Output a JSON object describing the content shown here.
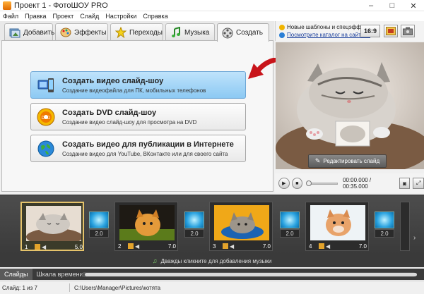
{
  "window": {
    "title": "Проект 1 - ФотоШОУ PRO",
    "controls": {
      "minimize": "–",
      "maximize": "□",
      "close": "✕"
    }
  },
  "menu": [
    "Файл",
    "Правка",
    "Проект",
    "Слайд",
    "Настройки",
    "Справка"
  ],
  "tabs": [
    {
      "label": "Добавить",
      "icon": "add-photos-icon"
    },
    {
      "label": "Эффекты",
      "icon": "palette-icon"
    },
    {
      "label": "Переходы",
      "icon": "star-icon"
    },
    {
      "label": "Музыка",
      "icon": "music-note-icon"
    },
    {
      "label": "Создать",
      "icon": "film-reel-icon",
      "active": true
    }
  ],
  "create_options": [
    {
      "title": "Создать видео слайд-шоу",
      "subtitle": "Создание видеофайла для ПК, мобильных телефонов",
      "selected": true
    },
    {
      "title": "Создать DVD слайд-шоу",
      "subtitle": "Создание видео слайд-шоу для просмотра на DVD"
    },
    {
      "title": "Создать видео для публикации в Интернете",
      "subtitle": "Создание видео для YouTube, ВКонтакте или для своего сайта"
    }
  ],
  "news": {
    "line1": "Новые шаблоны и спецэффекты",
    "line2": "Посмотрите каталог на сайте...."
  },
  "aspect_ratio": "16:9",
  "preview": {
    "edit_button": "Редактировать слайд"
  },
  "player": {
    "time": "00:00.000 / 00:35.000",
    "progress": 0
  },
  "slides": [
    {
      "number": "1",
      "duration": "5.0",
      "selected": true
    },
    {
      "number": "2",
      "duration": "7.0"
    },
    {
      "number": "3",
      "duration": "7.0"
    },
    {
      "number": "4",
      "duration": "7.0"
    }
  ],
  "transitions": [
    "2.0",
    "2.0",
    "2.0",
    "2.0"
  ],
  "music_hint": "Дважды кликните для добавления музыки",
  "bottom_tabs": [
    "Слайды",
    "Шкала времени"
  ],
  "status": {
    "slide": "Слайд: 1 из 7",
    "path": "C:\\Users\\Manager\\Pictures\\котята"
  },
  "colors": {
    "selected_option": "#8cc9f3",
    "timeline_bg": "#3a3a3a",
    "selected_slide_border": "#e5c36b",
    "arrow": "#c8141a"
  }
}
